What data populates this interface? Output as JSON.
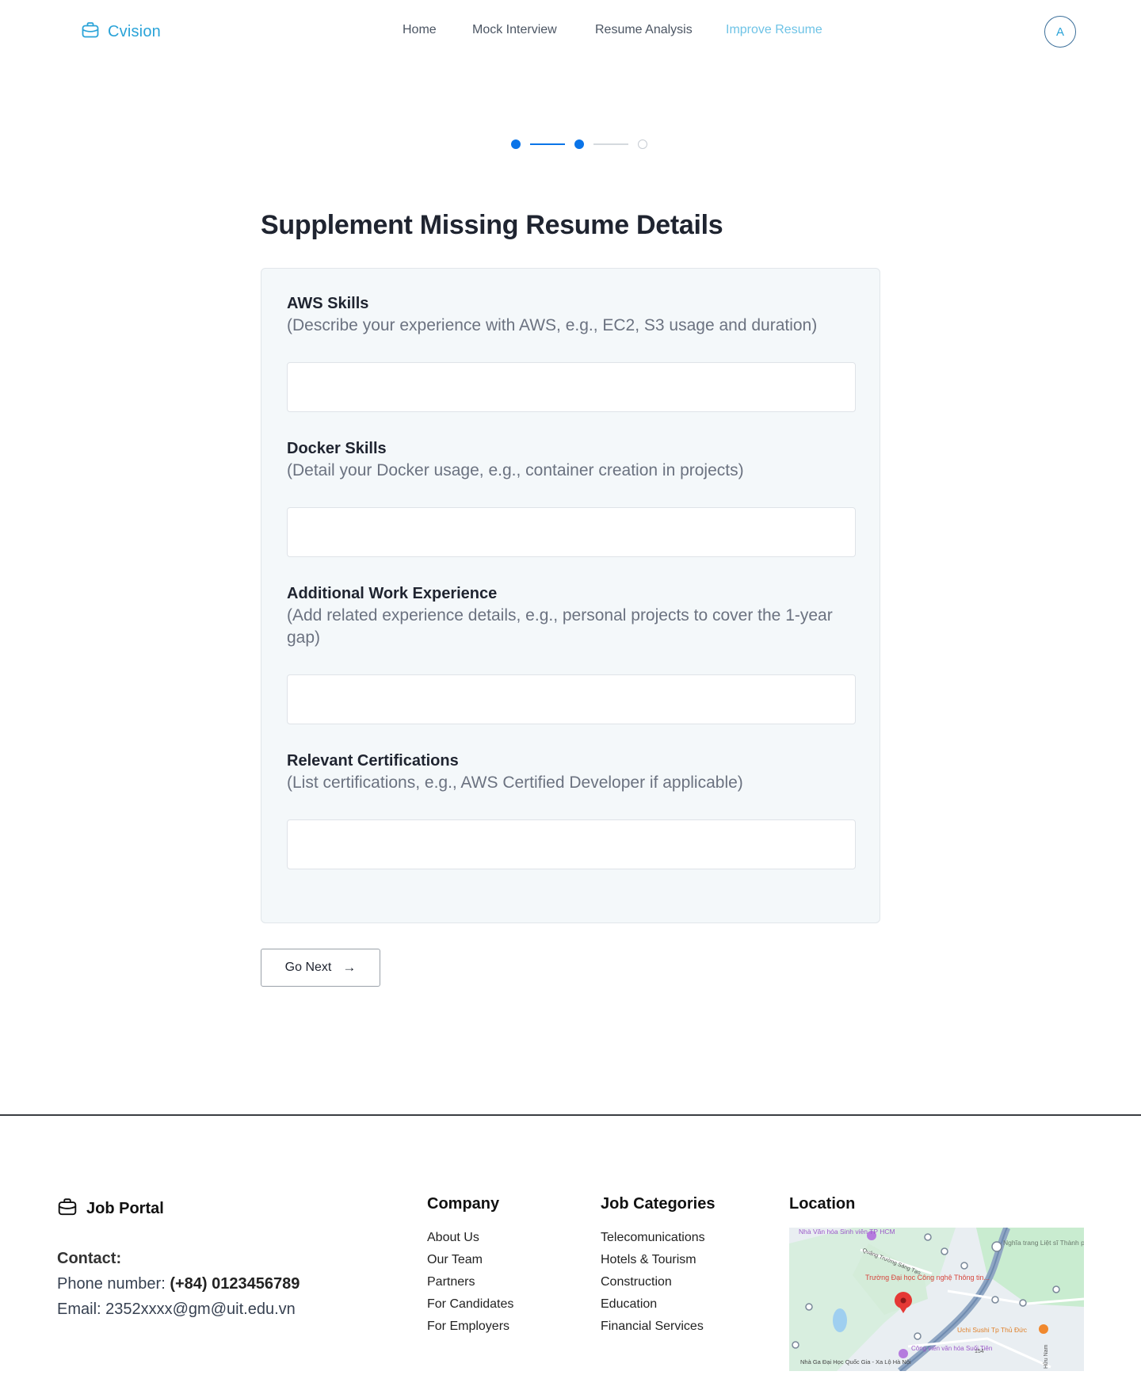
{
  "header": {
    "brand": "Cvision",
    "nav": [
      "Home",
      "Mock Interview",
      "Resume Analysis",
      "Improve Resume"
    ],
    "active_nav": "Improve Resume",
    "avatar_initial": "A"
  },
  "stepper": {
    "total_steps": 3,
    "completed_steps": 2
  },
  "page_title": "Supplement Missing Resume Details",
  "fields": [
    {
      "label": "AWS Skills",
      "hint": "(Describe your experience with AWS, e.g., EC2, S3 usage and duration)",
      "value": ""
    },
    {
      "label": "Docker Skills",
      "hint": "(Detail your Docker usage, e.g., container creation in projects)",
      "value": ""
    },
    {
      "label": "Additional Work Experience",
      "hint": "(Add related experience details, e.g., personal projects to cover the 1-year gap)",
      "value": ""
    },
    {
      "label": "Relevant Certifications",
      "hint": "(List certifications, e.g., AWS Certified Developer if applicable)",
      "value": ""
    }
  ],
  "next_button": "Go Next",
  "footer": {
    "brand": "Job Portal",
    "contact_heading": "Contact:",
    "phone_label": "Phone number:",
    "phone": "(+84) 0123456789",
    "email_label": "Email:",
    "email": "2352xxxx@gm@uit.edu.vn",
    "company": {
      "title": "Company",
      "links": [
        "About Us",
        "Our Team",
        "Partners",
        "For Candidates",
        "For Employers"
      ]
    },
    "categories": {
      "title": "Job Categories",
      "links": [
        "Telecomunications",
        "Hotels & Tourism",
        "Construction",
        "Education",
        "Financial Services"
      ]
    },
    "location": {
      "title": "Location",
      "map_labels": [
        "Nhà Văn hóa Sinh viên TP HCM",
        "Nghĩa trang Liệt sĩ Thành phố Hồ Chí Minh",
        "Quảng Trường Sáng Tạo",
        "Trường Đại học Công nghệ Thông tin...",
        "Uchi Sushi Tp Thủ Đức",
        "Công viên văn hóa Suối Tiên",
        "Nhà Ga Đại Học Quốc Gia - Xa Lộ Hà Nội",
        "154",
        "Hữu Nam"
      ]
    }
  },
  "colors": {
    "brand": "#2aa3d8",
    "active_nav": "#6ec3e6",
    "step_active": "#0a74e8",
    "card_bg": "#f4f8fa"
  }
}
